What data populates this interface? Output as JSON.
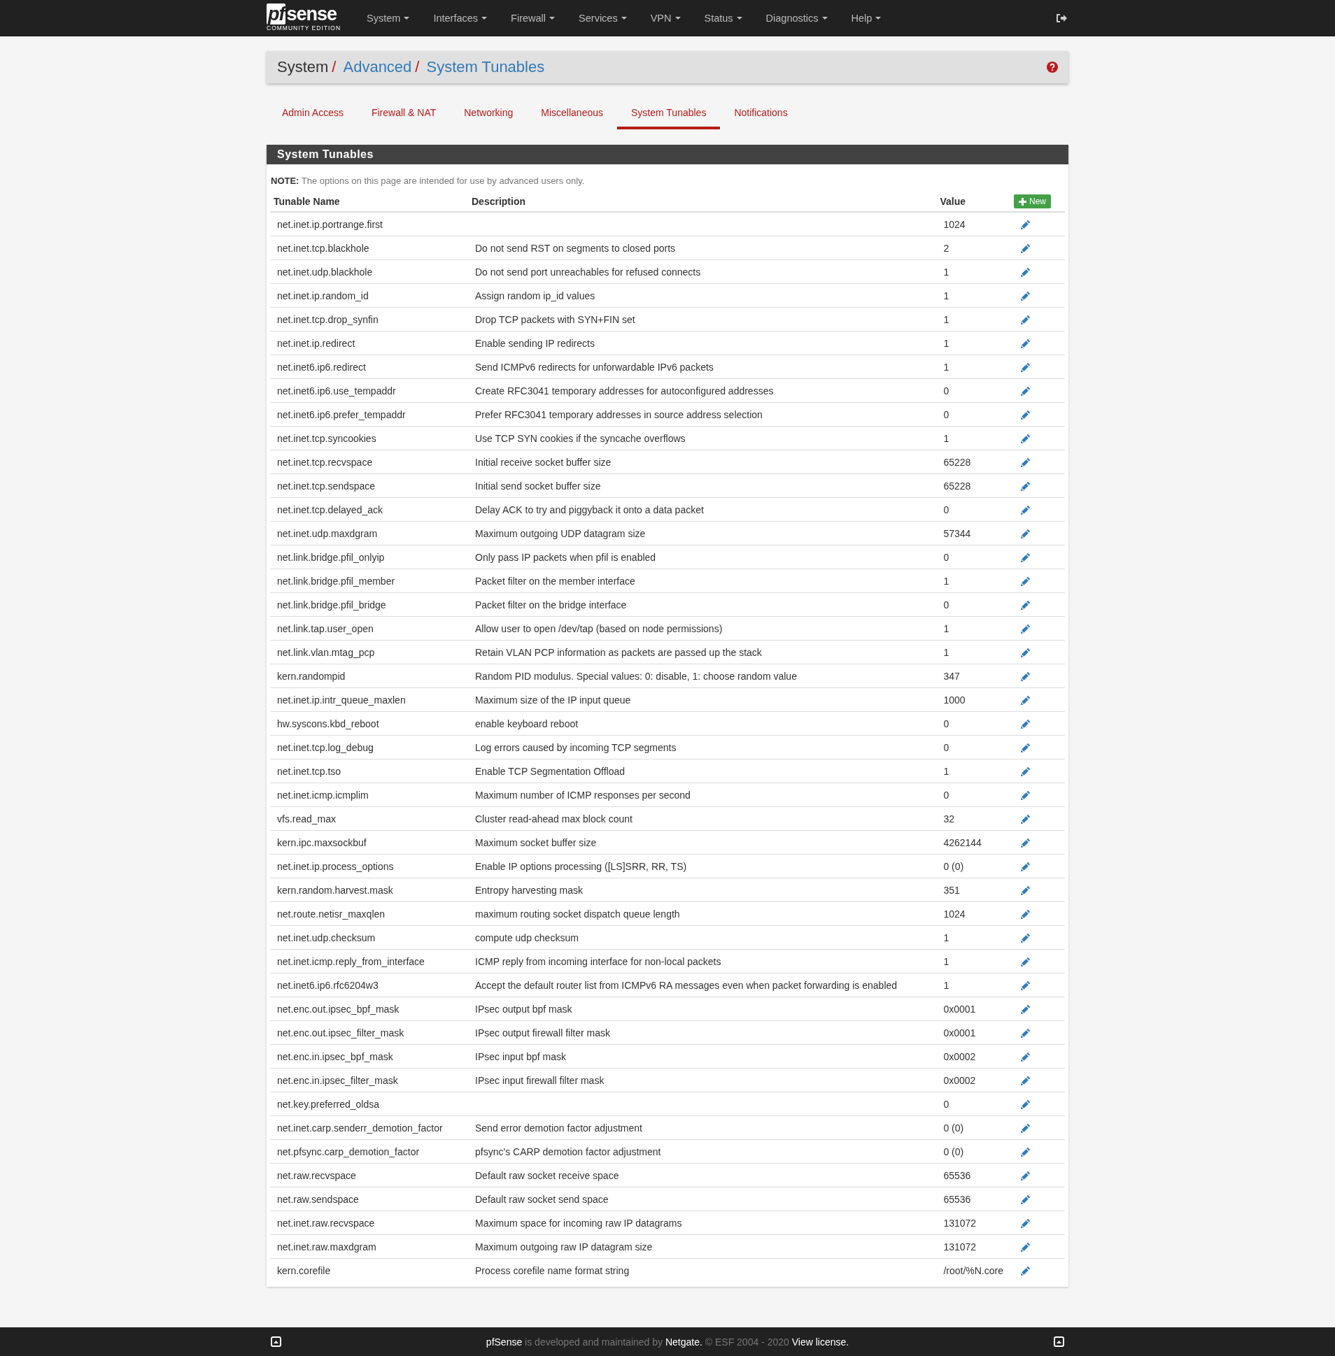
{
  "navbar": {
    "logo": {
      "prefix": "pf",
      "name": "sense",
      "edition": "COMMUNITY EDITION"
    },
    "menus": [
      "System",
      "Interfaces",
      "Firewall",
      "Services",
      "VPN",
      "Status",
      "Diagnostics",
      "Help"
    ]
  },
  "breadcrumb": {
    "separator": "/",
    "items": [
      {
        "text": "System",
        "link": false
      },
      {
        "text": "Advanced",
        "link": true
      },
      {
        "text": "System Tunables",
        "link": true
      }
    ]
  },
  "tabs": [
    {
      "label": "Admin Access",
      "selected": false
    },
    {
      "label": "Firewall & NAT",
      "selected": false
    },
    {
      "label": "Networking",
      "selected": false
    },
    {
      "label": "Miscellaneous",
      "selected": false
    },
    {
      "label": "System Tunables",
      "selected": true
    },
    {
      "label": "Notifications",
      "selected": false
    }
  ],
  "panel": {
    "title": "System Tunables",
    "note_label": "NOTE:",
    "note": " The options on this page are intended for use by advanced users only.",
    "columns": [
      "Tunable Name",
      "Description",
      "Value"
    ],
    "new_button": "New",
    "rows": [
      {
        "name": "net.inet.ip.portrange.first",
        "value": "1024"
      },
      {
        "name": "net.inet.tcp.blackhole",
        "description": "Do not send RST on segments to closed ports",
        "value": "2"
      },
      {
        "name": "net.inet.udp.blackhole",
        "description": "Do not send port unreachables for refused connects",
        "value": "1"
      },
      {
        "name": "net.inet.ip.random_id",
        "description": "Assign random ip_id values",
        "value": "1"
      },
      {
        "name": "net.inet.tcp.drop_synfin",
        "description": "Drop TCP packets with SYN+FIN set",
        "value": "1"
      },
      {
        "name": "net.inet.ip.redirect",
        "description": "Enable sending IP redirects",
        "value": "1"
      },
      {
        "name": "net.inet6.ip6.redirect",
        "description": "Send ICMPv6 redirects for unforwardable IPv6 packets",
        "value": "1"
      },
      {
        "name": "net.inet6.ip6.use_tempaddr",
        "description": "Create RFC3041 temporary addresses for autoconfigured addresses",
        "value": "0"
      },
      {
        "name": "net.inet6.ip6.prefer_tempaddr",
        "description": "Prefer RFC3041 temporary addresses in source address selection",
        "value": "0"
      },
      {
        "name": "net.inet.tcp.syncookies",
        "description": "Use TCP SYN cookies if the syncache overflows",
        "value": "1"
      },
      {
        "name": "net.inet.tcp.recvspace",
        "description": "Initial receive socket buffer size",
        "value": "65228"
      },
      {
        "name": "net.inet.tcp.sendspace",
        "description": "Initial send socket buffer size",
        "value": "65228"
      },
      {
        "name": "net.inet.tcp.delayed_ack",
        "description": "Delay ACK to try and piggyback it onto a data packet",
        "value": "0"
      },
      {
        "name": "net.inet.udp.maxdgram",
        "description": "Maximum outgoing UDP datagram size",
        "value": "57344"
      },
      {
        "name": "net.link.bridge.pfil_onlyip",
        "description": "Only pass IP packets when pfil is enabled",
        "value": "0"
      },
      {
        "name": "net.link.bridge.pfil_member",
        "description": "Packet filter on the member interface",
        "value": "1"
      },
      {
        "name": "net.link.bridge.pfil_bridge",
        "description": "Packet filter on the bridge interface",
        "value": "0"
      },
      {
        "name": "net.link.tap.user_open",
        "description": "Allow user to open /dev/tap (based on node permissions)",
        "value": "1"
      },
      {
        "name": "net.link.vlan.mtag_pcp",
        "description": "Retain VLAN PCP information as packets are passed up the stack",
        "value": "1"
      },
      {
        "name": "kern.randompid",
        "description": "Random PID modulus. Special values: 0: disable, 1: choose random value",
        "value": "347"
      },
      {
        "name": "net.inet.ip.intr_queue_maxlen",
        "description": "Maximum size of the IP input queue",
        "value": "1000"
      },
      {
        "name": "hw.syscons.kbd_reboot",
        "description": "enable keyboard reboot",
        "value": "0"
      },
      {
        "name": "net.inet.tcp.log_debug",
        "description": "Log errors caused by incoming TCP segments",
        "value": "0"
      },
      {
        "name": "net.inet.tcp.tso",
        "description": "Enable TCP Segmentation Offload",
        "value": "1"
      },
      {
        "name": "net.inet.icmp.icmplim",
        "description": "Maximum number of ICMP responses per second",
        "value": "0"
      },
      {
        "name": "vfs.read_max",
        "description": "Cluster read-ahead max block count",
        "value": "32"
      },
      {
        "name": "kern.ipc.maxsockbuf",
        "description": "Maximum socket buffer size",
        "value": "4262144"
      },
      {
        "name": "net.inet.ip.process_options",
        "description": "Enable IP options processing ([LS]SRR, RR, TS)",
        "value": "0 (0)"
      },
      {
        "name": "kern.random.harvest.mask",
        "description": "Entropy harvesting mask",
        "value": "351"
      },
      {
        "name": "net.route.netisr_maxqlen",
        "description": "maximum routing socket dispatch queue length",
        "value": "1024"
      },
      {
        "name": "net.inet.udp.checksum",
        "description": "compute udp checksum",
        "value": "1"
      },
      {
        "name": "net.inet.icmp.reply_from_interface",
        "description": "ICMP reply from incoming interface for non-local packets",
        "value": "1"
      },
      {
        "name": "net.inet6.ip6.rfc6204w3",
        "description": "Accept the default router list from ICMPv6 RA messages even when packet forwarding is enabled",
        "value": "1"
      },
      {
        "name": "net.enc.out.ipsec_bpf_mask",
        "description": "IPsec output bpf mask",
        "value": "0x0001"
      },
      {
        "name": "net.enc.out.ipsec_filter_mask",
        "description": "IPsec output firewall filter mask",
        "value": "0x0001"
      },
      {
        "name": "net.enc.in.ipsec_bpf_mask",
        "description": "IPsec input bpf mask",
        "value": "0x0002"
      },
      {
        "name": "net.enc.in.ipsec_filter_mask",
        "description": "IPsec input firewall filter mask",
        "value": "0x0002"
      },
      {
        "name": "net.key.preferred_oldsa",
        "value": "0"
      },
      {
        "name": "net.inet.carp.senderr_demotion_factor",
        "description": "Send error demotion factor adjustment",
        "value": "0 (0)"
      },
      {
        "name": "net.pfsync.carp_demotion_factor",
        "description": "pfsync's CARP demotion factor adjustment",
        "value": "0 (0)"
      },
      {
        "name": "net.raw.recvspace",
        "description": "Default raw socket receive space",
        "value": "65536"
      },
      {
        "name": "net.raw.sendspace",
        "description": "Default raw socket send space",
        "value": "65536"
      },
      {
        "name": "net.inet.raw.recvspace",
        "description": "Maximum space for incoming raw IP datagrams",
        "value": "131072"
      },
      {
        "name": "net.inet.raw.maxdgram",
        "description": "Maximum outgoing raw IP datagram size",
        "value": "131072"
      },
      {
        "name": "kern.corefile",
        "description": "Process corefile name format string",
        "value": "/root/%N.core"
      }
    ]
  },
  "footer": {
    "parts": [
      {
        "text": "pfSense",
        "kind": "link"
      },
      {
        "text": " is developed and maintained by ",
        "kind": "text"
      },
      {
        "text": "Netgate.",
        "kind": "link"
      },
      {
        "text": " © ESF 2004 - 2020 ",
        "kind": "text"
      },
      {
        "text": "View license.",
        "kind": "link"
      }
    ]
  }
}
